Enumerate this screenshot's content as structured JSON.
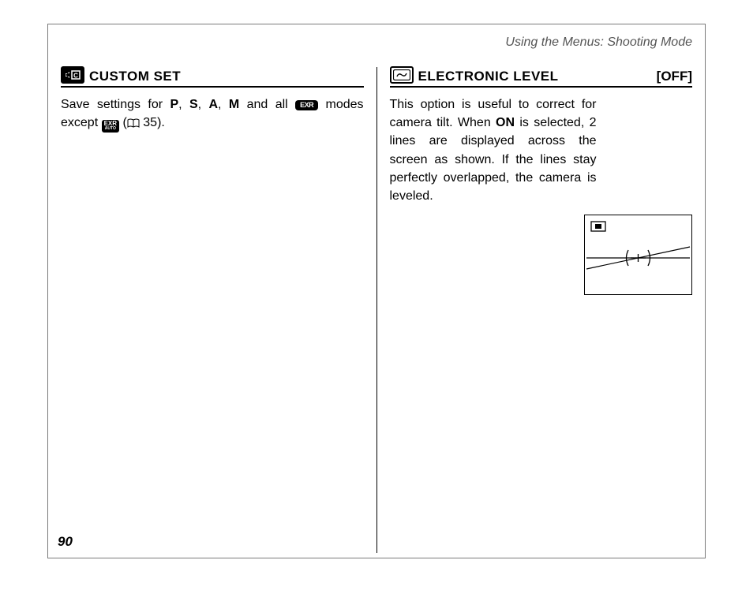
{
  "header": {
    "breadcrumb": "Using the Menus: Shooting Mode"
  },
  "left": {
    "icon_label": "C",
    "title": "CUSTOM SET",
    "body_pre": "Save settings for ",
    "p": "P",
    "s": "S",
    "a": "A",
    "m": "M",
    "mid1": ", ",
    "mid2": ", ",
    "mid3": ", ",
    "and_all": " and all ",
    "exr": "EXR",
    "modes_except": " modes except ",
    "exr_auto_top": "EXR",
    "exr_auto_bottom": "AUTO",
    "paren_open": " (",
    "page_ref": " 35).",
    "book_aria": "page-reference-icon"
  },
  "right": {
    "title": "ELECTRONIC LEVEL",
    "status": "[OFF]",
    "body_pre": "This option is useful to correct for camera tilt.  When ",
    "on": "ON",
    "body_post": " is selected, 2 lines are displayed across the screen as shown.  If the lines stay perfectly over­lapped, the camera is leveled."
  },
  "page_number": "90"
}
